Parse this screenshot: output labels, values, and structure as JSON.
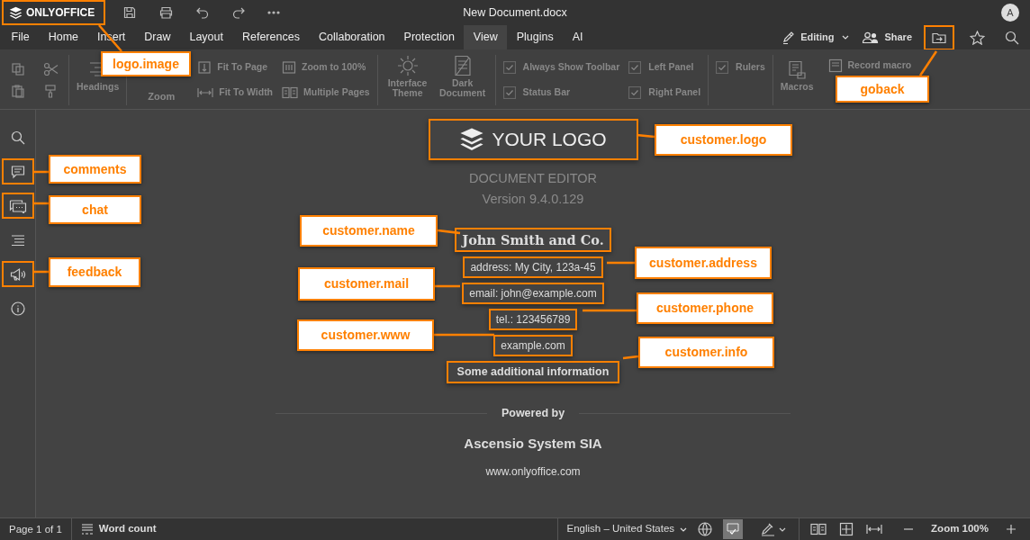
{
  "title_bar": {
    "logo_text": "ONLYOFFICE",
    "document_title": "New Document.docx",
    "avatar_initial": "A"
  },
  "menu_tabs": [
    {
      "label": "File",
      "selected": false
    },
    {
      "label": "Home",
      "selected": false
    },
    {
      "label": "Insert",
      "selected": false
    },
    {
      "label": "Draw",
      "selected": false
    },
    {
      "label": "Layout",
      "selected": false
    },
    {
      "label": "References",
      "selected": false
    },
    {
      "label": "Collaboration",
      "selected": false
    },
    {
      "label": "Protection",
      "selected": false
    },
    {
      "label": "View",
      "selected": true
    },
    {
      "label": "Plugins",
      "selected": false
    },
    {
      "label": "AI",
      "selected": false
    }
  ],
  "header_actions": {
    "editing": "Editing",
    "share": "Share"
  },
  "ribbon": {
    "headings": "Headings",
    "zoom_label": "Zoom",
    "fit_to_page": "Fit To Page",
    "fit_to_width": "Fit To Width",
    "zoom_to_100": "Zoom to 100%",
    "multiple_pages": "Multiple Pages",
    "interface_theme": "Interface Theme",
    "dark_document": "Dark Document",
    "checkboxes": [
      {
        "label": "Always Show Toolbar",
        "checked": true
      },
      {
        "label": "Status Bar",
        "checked": true
      },
      {
        "label": "Left Panel",
        "checked": true
      },
      {
        "label": "Right Panel",
        "checked": true
      },
      {
        "label": "Rulers",
        "checked": true
      }
    ],
    "macros": "Macros",
    "record_macro": "Record macro"
  },
  "about": {
    "logo_text": "YOUR LOGO",
    "product": "DOCUMENT EDITOR",
    "version": "Version 9.4.0.129",
    "customer_name": "John Smith and Co.",
    "address": "address: My City, 123a-45",
    "email": "email: john@example.com",
    "phone": "tel.: 123456789",
    "www": "example.com",
    "info": "Some additional information",
    "powered_by": "Powered by",
    "company": "Ascensio System SIA",
    "site": "www.onlyoffice.com"
  },
  "status_bar": {
    "page": "Page 1 of 1",
    "word_count": "Word count",
    "language": "English – United States",
    "spellcheck_on": true,
    "zoom": "Zoom 100%"
  },
  "callouts": [
    {
      "label": "logo.image"
    },
    {
      "label": "goback"
    },
    {
      "label": "comments"
    },
    {
      "label": "chat"
    },
    {
      "label": "feedback"
    },
    {
      "label": "customer.logo"
    },
    {
      "label": "customer.name"
    },
    {
      "label": "customer.address"
    },
    {
      "label": "customer.mail"
    },
    {
      "label": "customer.phone"
    },
    {
      "label": "customer.www"
    },
    {
      "label": "customer.info"
    }
  ]
}
